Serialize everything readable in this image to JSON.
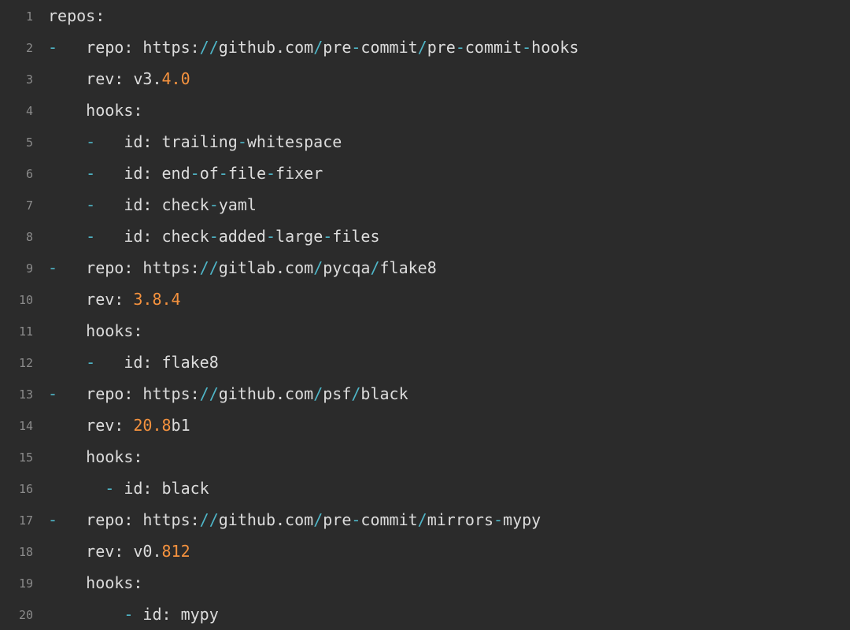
{
  "colors": {
    "background": "#2b2b2b",
    "text": "#dcdcdc",
    "line_number": "#8b8b8b",
    "punctuation": "#4fb6c8",
    "number": "#f5923e"
  },
  "lines": [
    {
      "n": "1",
      "tokens": [
        {
          "t": "repos:",
          "c": "text"
        }
      ]
    },
    {
      "n": "2",
      "tokens": [
        {
          "t": "-",
          "c": "dash"
        },
        {
          "t": "   repo: https:",
          "c": "text"
        },
        {
          "t": "//",
          "c": "dash"
        },
        {
          "t": "github.com",
          "c": "text"
        },
        {
          "t": "/",
          "c": "dash"
        },
        {
          "t": "pre",
          "c": "text"
        },
        {
          "t": "-",
          "c": "dash"
        },
        {
          "t": "commit",
          "c": "text"
        },
        {
          "t": "/",
          "c": "dash"
        },
        {
          "t": "pre",
          "c": "text"
        },
        {
          "t": "-",
          "c": "dash"
        },
        {
          "t": "commit",
          "c": "text"
        },
        {
          "t": "-",
          "c": "dash"
        },
        {
          "t": "hooks",
          "c": "text"
        }
      ]
    },
    {
      "n": "3",
      "tokens": [
        {
          "t": "    rev: v3.",
          "c": "text"
        },
        {
          "t": "4.0",
          "c": "num"
        }
      ]
    },
    {
      "n": "4",
      "tokens": [
        {
          "t": "    hooks:",
          "c": "text"
        }
      ]
    },
    {
      "n": "5",
      "tokens": [
        {
          "t": "    ",
          "c": "text"
        },
        {
          "t": "-",
          "c": "dash"
        },
        {
          "t": "   id: trailing",
          "c": "text"
        },
        {
          "t": "-",
          "c": "dash"
        },
        {
          "t": "whitespace",
          "c": "text"
        }
      ]
    },
    {
      "n": "6",
      "tokens": [
        {
          "t": "    ",
          "c": "text"
        },
        {
          "t": "-",
          "c": "dash"
        },
        {
          "t": "   id: end",
          "c": "text"
        },
        {
          "t": "-",
          "c": "dash"
        },
        {
          "t": "of",
          "c": "text"
        },
        {
          "t": "-",
          "c": "dash"
        },
        {
          "t": "file",
          "c": "text"
        },
        {
          "t": "-",
          "c": "dash"
        },
        {
          "t": "fixer",
          "c": "text"
        }
      ]
    },
    {
      "n": "7",
      "tokens": [
        {
          "t": "    ",
          "c": "text"
        },
        {
          "t": "-",
          "c": "dash"
        },
        {
          "t": "   id: check",
          "c": "text"
        },
        {
          "t": "-",
          "c": "dash"
        },
        {
          "t": "yaml",
          "c": "text"
        }
      ]
    },
    {
      "n": "8",
      "tokens": [
        {
          "t": "    ",
          "c": "text"
        },
        {
          "t": "-",
          "c": "dash"
        },
        {
          "t": "   id: check",
          "c": "text"
        },
        {
          "t": "-",
          "c": "dash"
        },
        {
          "t": "added",
          "c": "text"
        },
        {
          "t": "-",
          "c": "dash"
        },
        {
          "t": "large",
          "c": "text"
        },
        {
          "t": "-",
          "c": "dash"
        },
        {
          "t": "files",
          "c": "text"
        }
      ]
    },
    {
      "n": "9",
      "tokens": [
        {
          "t": "-",
          "c": "dash"
        },
        {
          "t": "   repo: https:",
          "c": "text"
        },
        {
          "t": "//",
          "c": "dash"
        },
        {
          "t": "gitlab.com",
          "c": "text"
        },
        {
          "t": "/",
          "c": "dash"
        },
        {
          "t": "pycqa",
          "c": "text"
        },
        {
          "t": "/",
          "c": "dash"
        },
        {
          "t": "flake8",
          "c": "text"
        }
      ]
    },
    {
      "n": "10",
      "tokens": [
        {
          "t": "    rev: ",
          "c": "text"
        },
        {
          "t": "3.8.4",
          "c": "num"
        }
      ]
    },
    {
      "n": "11",
      "tokens": [
        {
          "t": "    hooks:",
          "c": "text"
        }
      ]
    },
    {
      "n": "12",
      "tokens": [
        {
          "t": "    ",
          "c": "text"
        },
        {
          "t": "-",
          "c": "dash"
        },
        {
          "t": "   id: flake8",
          "c": "text"
        }
      ]
    },
    {
      "n": "13",
      "tokens": [
        {
          "t": "-",
          "c": "dash"
        },
        {
          "t": "   repo: https:",
          "c": "text"
        },
        {
          "t": "//",
          "c": "dash"
        },
        {
          "t": "github.com",
          "c": "text"
        },
        {
          "t": "/",
          "c": "dash"
        },
        {
          "t": "psf",
          "c": "text"
        },
        {
          "t": "/",
          "c": "dash"
        },
        {
          "t": "black",
          "c": "text"
        }
      ]
    },
    {
      "n": "14",
      "tokens": [
        {
          "t": "    rev: ",
          "c": "text"
        },
        {
          "t": "20.8",
          "c": "num"
        },
        {
          "t": "b1",
          "c": "text"
        }
      ]
    },
    {
      "n": "15",
      "tokens": [
        {
          "t": "    hooks:",
          "c": "text"
        }
      ]
    },
    {
      "n": "16",
      "tokens": [
        {
          "t": "      ",
          "c": "text"
        },
        {
          "t": "-",
          "c": "dash"
        },
        {
          "t": " id: black",
          "c": "text"
        }
      ]
    },
    {
      "n": "17",
      "tokens": [
        {
          "t": "-",
          "c": "dash"
        },
        {
          "t": "   repo: https:",
          "c": "text"
        },
        {
          "t": "//",
          "c": "dash"
        },
        {
          "t": "github.com",
          "c": "text"
        },
        {
          "t": "/",
          "c": "dash"
        },
        {
          "t": "pre",
          "c": "text"
        },
        {
          "t": "-",
          "c": "dash"
        },
        {
          "t": "commit",
          "c": "text"
        },
        {
          "t": "/",
          "c": "dash"
        },
        {
          "t": "mirrors",
          "c": "text"
        },
        {
          "t": "-",
          "c": "dash"
        },
        {
          "t": "mypy",
          "c": "text"
        }
      ]
    },
    {
      "n": "18",
      "tokens": [
        {
          "t": "    rev: v0.",
          "c": "text"
        },
        {
          "t": "812",
          "c": "num"
        }
      ]
    },
    {
      "n": "19",
      "tokens": [
        {
          "t": "    hooks:",
          "c": "text"
        }
      ]
    },
    {
      "n": "20",
      "tokens": [
        {
          "t": "        ",
          "c": "text"
        },
        {
          "t": "-",
          "c": "dash"
        },
        {
          "t": " id: mypy",
          "c": "text"
        }
      ]
    }
  ]
}
